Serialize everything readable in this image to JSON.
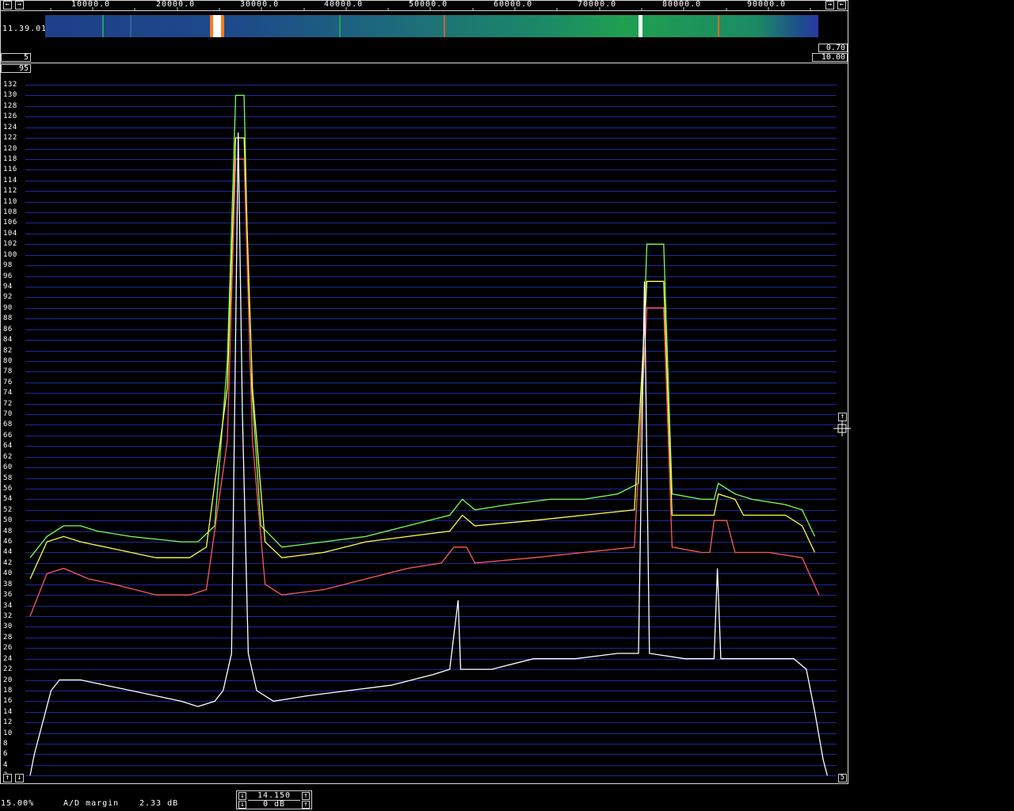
{
  "freq_axis": {
    "labels": [
      "10000.0",
      "20000.0",
      "30000.0",
      "40000.0",
      "50000.0",
      "60000.0",
      "70000.0",
      "80000.0",
      "90000.0"
    ],
    "left_arrow": "←",
    "right_arrow": "→"
  },
  "waterfall": {
    "timestamp": "11.39.01",
    "right_box_top": "0.70",
    "right_box_bottom": "10.00",
    "left_box_top": "5",
    "left_box_bottom": "95",
    "colors": {
      "low": "#1e3f8a",
      "mid": "#1a6a78",
      "high": "#1fa05a",
      "hot": "#ffffff",
      "warm": "#ff7a1a"
    }
  },
  "spectrum": {
    "y_labels": [
      "132",
      "130",
      "128",
      "126",
      "124",
      "122",
      "120",
      "118",
      "116",
      "114",
      "112",
      "110",
      "108",
      "106",
      "104",
      "102",
      "100",
      "98",
      "96",
      "94",
      "92",
      "90",
      "88",
      "86",
      "84",
      "82",
      "80",
      "78",
      "76",
      "74",
      "72",
      "70",
      "68",
      "66",
      "64",
      "62",
      "60",
      "58",
      "56",
      "54",
      "52",
      "50",
      "48",
      "46",
      "44",
      "42",
      "40",
      "38",
      "36",
      "34",
      "32",
      "30",
      "28",
      "26",
      "24",
      "22",
      "20",
      "18",
      "16",
      "14",
      "12",
      "10",
      "8",
      "6",
      "4",
      "2"
    ],
    "grid_color": "#1c2a9a",
    "bottom_left_up": "↑",
    "bottom_left_down": "↓",
    "bottom_right_value": "5",
    "right_scroll_up": "↑",
    "right_scroll_down": "↓"
  },
  "status": {
    "percent": "15.00%",
    "ad_label": "A/D margin",
    "ad_value": "2.33 dB",
    "gain_top": "14.150",
    "gain_bottom": "0 dB"
  },
  "chart_data": {
    "type": "line",
    "xlim": [
      0,
      96000
    ],
    "ylim": [
      2,
      132
    ],
    "series": [
      {
        "color": "#7cff5a",
        "values": [
          [
            0,
            43
          ],
          [
            2000,
            47
          ],
          [
            4000,
            49
          ],
          [
            6000,
            49
          ],
          [
            8000,
            48
          ],
          [
            12000,
            47
          ],
          [
            18000,
            46
          ],
          [
            20000,
            46
          ],
          [
            22000,
            49
          ],
          [
            23500,
            80
          ],
          [
            24500,
            130
          ],
          [
            25500,
            130
          ],
          [
            26200,
            80
          ],
          [
            27500,
            49
          ],
          [
            30000,
            45
          ],
          [
            35000,
            46
          ],
          [
            40000,
            47
          ],
          [
            45000,
            49
          ],
          [
            50000,
            51
          ],
          [
            51500,
            54
          ],
          [
            53000,
            52
          ],
          [
            57000,
            53
          ],
          [
            62000,
            54
          ],
          [
            66000,
            54
          ],
          [
            70000,
            55
          ],
          [
            72500,
            57
          ],
          [
            73500,
            102
          ],
          [
            75500,
            102
          ],
          [
            76500,
            55
          ],
          [
            80000,
            54
          ],
          [
            81500,
            54
          ],
          [
            82000,
            57
          ],
          [
            84000,
            55
          ],
          [
            86000,
            54
          ],
          [
            90000,
            53
          ],
          [
            92000,
            52
          ],
          [
            93500,
            47
          ]
        ]
      },
      {
        "color": "#ffff4a",
        "values": [
          [
            0,
            39
          ],
          [
            2000,
            46
          ],
          [
            4000,
            47
          ],
          [
            6000,
            46
          ],
          [
            9000,
            45
          ],
          [
            15000,
            43
          ],
          [
            19000,
            43
          ],
          [
            21000,
            45
          ],
          [
            23500,
            75
          ],
          [
            24500,
            122
          ],
          [
            25500,
            122
          ],
          [
            26500,
            75
          ],
          [
            28000,
            46
          ],
          [
            30000,
            43
          ],
          [
            35000,
            44
          ],
          [
            40000,
            46
          ],
          [
            45000,
            47
          ],
          [
            50000,
            48
          ],
          [
            51500,
            51
          ],
          [
            53000,
            49
          ],
          [
            60000,
            50
          ],
          [
            66000,
            51
          ],
          [
            72000,
            52
          ],
          [
            73500,
            95
          ],
          [
            75500,
            95
          ],
          [
            76500,
            51
          ],
          [
            80000,
            51
          ],
          [
            81500,
            51
          ],
          [
            82000,
            55
          ],
          [
            84000,
            54
          ],
          [
            85000,
            51
          ],
          [
            90000,
            51
          ],
          [
            92000,
            49
          ],
          [
            93500,
            44
          ]
        ]
      },
      {
        "color": "#ff5a5a",
        "values": [
          [
            0,
            32
          ],
          [
            2000,
            40
          ],
          [
            4000,
            41
          ],
          [
            7000,
            39
          ],
          [
            10000,
            38
          ],
          [
            15000,
            36
          ],
          [
            19000,
            36
          ],
          [
            21000,
            37
          ],
          [
            23500,
            65
          ],
          [
            24500,
            118
          ],
          [
            25500,
            118
          ],
          [
            26500,
            65
          ],
          [
            28000,
            38
          ],
          [
            30000,
            36
          ],
          [
            35000,
            37
          ],
          [
            40000,
            39
          ],
          [
            45000,
            41
          ],
          [
            49000,
            42
          ],
          [
            50500,
            45
          ],
          [
            52000,
            45
          ],
          [
            53000,
            42
          ],
          [
            60000,
            43
          ],
          [
            66000,
            44
          ],
          [
            72000,
            45
          ],
          [
            73500,
            90
          ],
          [
            75500,
            90
          ],
          [
            76500,
            45
          ],
          [
            80000,
            44
          ],
          [
            81000,
            44
          ],
          [
            81500,
            50
          ],
          [
            83000,
            50
          ],
          [
            84000,
            44
          ],
          [
            88000,
            44
          ],
          [
            92000,
            43
          ],
          [
            94000,
            36
          ]
        ]
      },
      {
        "color": "#ffffff",
        "values": [
          [
            0,
            2
          ],
          [
            500,
            6
          ],
          [
            1500,
            12
          ],
          [
            2500,
            18
          ],
          [
            3500,
            20
          ],
          [
            6000,
            20
          ],
          [
            9000,
            19
          ],
          [
            12000,
            18
          ],
          [
            15000,
            17
          ],
          [
            18000,
            16
          ],
          [
            20000,
            15
          ],
          [
            22000,
            16
          ],
          [
            23000,
            18
          ],
          [
            24000,
            25
          ],
          [
            24800,
            123
          ],
          [
            25300,
            70
          ],
          [
            26000,
            25
          ],
          [
            27000,
            18
          ],
          [
            29000,
            16
          ],
          [
            33000,
            17
          ],
          [
            38000,
            18
          ],
          [
            43000,
            19
          ],
          [
            48000,
            21
          ],
          [
            50000,
            22
          ],
          [
            51000,
            35
          ],
          [
            51300,
            22
          ],
          [
            55000,
            22
          ],
          [
            60000,
            24
          ],
          [
            65000,
            24
          ],
          [
            70000,
            25
          ],
          [
            72500,
            25
          ],
          [
            73200,
            95
          ],
          [
            73800,
            25
          ],
          [
            78000,
            24
          ],
          [
            81500,
            24
          ],
          [
            81900,
            41
          ],
          [
            82300,
            24
          ],
          [
            86000,
            24
          ],
          [
            91000,
            24
          ],
          [
            92500,
            22
          ],
          [
            93500,
            14
          ],
          [
            94500,
            5
          ],
          [
            95000,
            2
          ]
        ]
      }
    ]
  }
}
